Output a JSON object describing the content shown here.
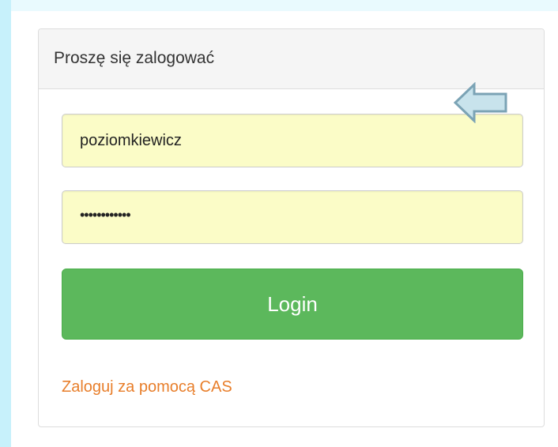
{
  "login_panel": {
    "heading": "Proszę się zalogować",
    "username_value": "poziomkiewicz",
    "password_masked": "••••••••••••",
    "login_button_label": "Login",
    "cas_link_label": "Zaloguj za pomocą CAS"
  },
  "annotation": {
    "icon": "left-arrow-icon",
    "fill_color": "#c8e3ec",
    "stroke_color": "#7ba3b5"
  },
  "colors": {
    "field_background": "#fbfcc7",
    "button_green": "#5cb85c",
    "link_orange": "#e87e2a"
  }
}
